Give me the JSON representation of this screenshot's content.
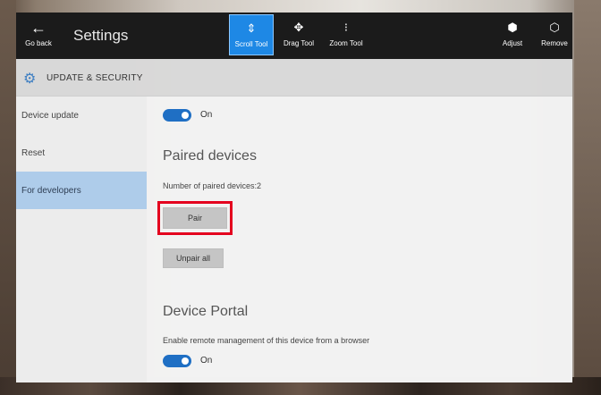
{
  "toolbar": {
    "back_label": "Go back",
    "title": "Settings",
    "tools": [
      {
        "label": "Scroll Tool",
        "icon": "scroll-arrows-icon",
        "active": true
      },
      {
        "label": "Drag Tool",
        "icon": "move-icon",
        "active": false
      },
      {
        "label": "Zoom Tool",
        "icon": "zoom-icon",
        "active": false
      }
    ],
    "adjust_label": "Adjust",
    "remove_label": "Remove"
  },
  "section": {
    "title": "UPDATE & SECURITY",
    "icon": "gear-icon"
  },
  "nav": {
    "items": [
      {
        "label": "Device update",
        "selected": false
      },
      {
        "label": "Reset",
        "selected": false
      },
      {
        "label": "For developers",
        "selected": true
      }
    ]
  },
  "main": {
    "top_toggle": {
      "state": "On",
      "on": true
    },
    "paired_devices": {
      "heading": "Paired devices",
      "count_text": "Number of paired devices:2",
      "pair_label": "Pair",
      "unpair_label": "Unpair all"
    },
    "device_portal": {
      "heading": "Device Portal",
      "description": "Enable remote management of this device from a browser",
      "toggle_state": "On",
      "on": true
    }
  },
  "colors": {
    "toolbar_bg": "#1b1b1b",
    "accent": "#1e88e5",
    "toggle_on": "#1f6fc4",
    "nav_selected": "#aeccea",
    "highlight": "#e4001e"
  }
}
